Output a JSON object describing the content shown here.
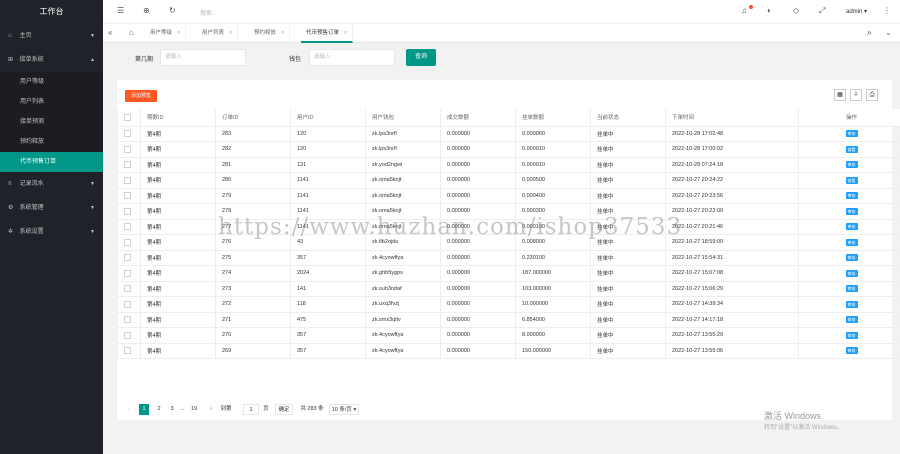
{
  "sidebar": {
    "logo": "工作台",
    "items": [
      {
        "icon": "home-icon",
        "label": "主页"
      },
      {
        "icon": "grid-icon",
        "label": "接单系统",
        "expanded": true,
        "children": [
          "用户等级",
          "用户列表",
          "接单预测",
          "预约释放",
          "代币预售订单"
        ]
      },
      {
        "icon": "list-icon",
        "label": "记录流水"
      },
      {
        "icon": "gear-icon",
        "label": "系统管理"
      },
      {
        "icon": "settings-icon",
        "label": "系统设置"
      }
    ],
    "active_child": "代币预售订单"
  },
  "header": {
    "search_placeholder": "搜索...",
    "admin": "admin"
  },
  "tabs": [
    {
      "label": "用户等级"
    },
    {
      "label": "用户列表"
    },
    {
      "label": "预约释放"
    },
    {
      "label": "代币预售订单",
      "active": true
    }
  ],
  "filter": {
    "f1_label": "第几期",
    "f1_placeholder": "请输入",
    "f2_label": "钱包",
    "f2_placeholder": "请输入",
    "query": "查询"
  },
  "toolbar": {
    "add": "添加预售"
  },
  "table": {
    "headers": [
      "",
      "期数ID",
      "订单ID",
      "用户ID",
      "用户钱包",
      "成交数额",
      "挂单数额",
      "当前状态",
      "下单时间",
      "操作"
    ],
    "rows": [
      [
        "第4期",
        "283",
        "120",
        "zk.lps3nrfl",
        "0.000000",
        "0.000060",
        "挂单中",
        "2022-10-28 17:02:48",
        "审核"
      ],
      [
        "第4期",
        "282",
        "120",
        "zk.lps3nrfl",
        "0.000000",
        "0.000010",
        "挂单中",
        "2022-10-28 17:00:02",
        "查看"
      ],
      [
        "第4期",
        "281",
        "131",
        "zk.yod2ngwl",
        "0.000000",
        "0.000010",
        "挂单中",
        "2022-10-28 07:24:18",
        "审核"
      ],
      [
        "第4期",
        "280",
        "1141",
        "zk.oma5knjt",
        "0.000000",
        "0.000500",
        "挂单中",
        "2022-10-27 20:24:22",
        "查看"
      ],
      [
        "第4期",
        "279",
        "1141",
        "zk.oma5knjt",
        "0.000000",
        "0.000400",
        "挂单中",
        "2022-10-27 20:23:56",
        "审核"
      ],
      [
        "第4期",
        "278",
        "1141",
        "zk.oma5knjt",
        "0.000000",
        "0.000300",
        "挂单中",
        "2022-10-27 20:23:00",
        "审核"
      ],
      [
        "第4期",
        "277",
        "1141",
        "zk.oma5knjt",
        "0.000000",
        "0.000100",
        "挂单中",
        "2022-10-27 20:21:46",
        "审核"
      ],
      [
        "第4期",
        "276",
        "43",
        "zk.fib2ojdu",
        "0.000000",
        "0.008000",
        "挂单中",
        "2022-10-27 18:59:00",
        "审核"
      ],
      [
        "第4期",
        "275",
        "357",
        "zk.4cyowftya",
        "0.000000",
        "0.230100",
        "挂单中",
        "2022-10-27 15:54:31",
        "审核"
      ],
      [
        "第4期",
        "274",
        "2024",
        "zk.ghb5ygps",
        "0.000000",
        "187.000000",
        "挂单中",
        "2022-10-27 15:07:08",
        "审核"
      ],
      [
        "第4期",
        "273",
        "141",
        "zk.suh3ndaf",
        "0.000000",
        "103.000000",
        "挂单中",
        "2022-10-27 15:06:29",
        "审核"
      ],
      [
        "第4期",
        "272",
        "118",
        "zk.uxq3fvzj",
        "0.000000",
        "10.000000",
        "挂单中",
        "2022-10-27 14:39:34",
        "审核"
      ],
      [
        "第4期",
        "271",
        "475",
        "zk.smx3qltv",
        "0.000000",
        "6.854000",
        "挂单中",
        "2022-10-27 14:17:18",
        "审核"
      ],
      [
        "第4期",
        "270",
        "357",
        "zk.4cyowftya",
        "0.000000",
        "8.000000",
        "挂单中",
        "2022-10-27 13:55:29",
        "审核"
      ],
      [
        "第4期",
        "269",
        "357",
        "zk.4cyowftya",
        "0.000000",
        "150.000000",
        "挂单中",
        "2022-10-27 13:55:06",
        "审核"
      ]
    ]
  },
  "pagination": {
    "pages": [
      "1",
      "2",
      "3",
      "...",
      "19"
    ],
    "goto": "到第",
    "goto_val": "1",
    "page_unit": "页",
    "confirm": "确定",
    "total": "共 283 条",
    "per_page": "10 条/页"
  },
  "watermark": "https://www.huzhan.com/ishop37533",
  "windows": {
    "line1": "激活 Windows",
    "line2": "转到\"设置\"以激活 Windows。"
  },
  "colors": {
    "accent": "#009688",
    "danger": "#ff5722",
    "info": "#1e9fff",
    "sidebar": "#20222a"
  }
}
